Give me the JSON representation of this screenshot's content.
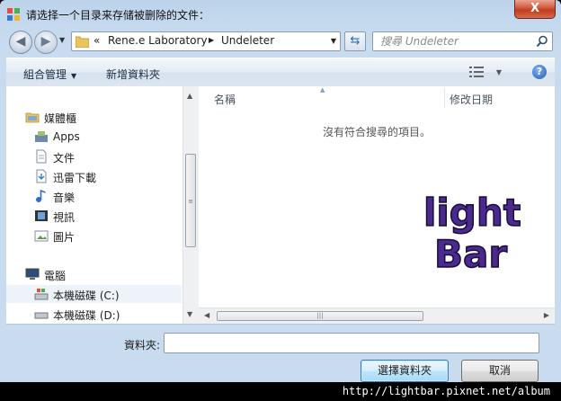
{
  "window": {
    "title": "请选择一个目录来存储被删除的文件：",
    "close_label": "X"
  },
  "address": {
    "prefix": "«",
    "segments": [
      "Rene.e Laboratory",
      "Undeleter"
    ],
    "search_placeholder": "搜尋 Undeleter"
  },
  "toolbar": {
    "organize_label": "組合管理",
    "new_folder_label": "新增資料夾",
    "help_label": "?"
  },
  "nav": {
    "items": [
      {
        "label": "媒體櫃",
        "icon": "library-icon"
      },
      {
        "label": "Apps",
        "icon": "apps-icon"
      },
      {
        "label": "文件",
        "icon": "document-icon"
      },
      {
        "label": "迅雷下載",
        "icon": "download-icon"
      },
      {
        "label": "音樂",
        "icon": "music-icon"
      },
      {
        "label": "視訊",
        "icon": "video-icon"
      },
      {
        "label": "圖片",
        "icon": "picture-icon"
      },
      {
        "label": "電腦",
        "icon": "computer-icon"
      },
      {
        "label": "本機磁碟 (C:)",
        "icon": "drive-c-icon"
      },
      {
        "label": "本機磁碟 (D:)",
        "icon": "drive-d-icon"
      }
    ]
  },
  "files": {
    "columns": [
      "名稱",
      "修改日期"
    ],
    "empty_message": "沒有符合搜尋的項目。"
  },
  "logo": {
    "line1": "light",
    "line2": "Bar"
  },
  "footer": {
    "folder_label": "資料夾:",
    "folder_value": "",
    "select_button": "選擇資料夾",
    "cancel_button": "取消"
  },
  "watermark_url": "http://lightbar.pixnet.net/album",
  "colors": {
    "accent": "#3c7fb1",
    "logo_fill": "#4a2a8c",
    "close": "#c13c1e"
  }
}
